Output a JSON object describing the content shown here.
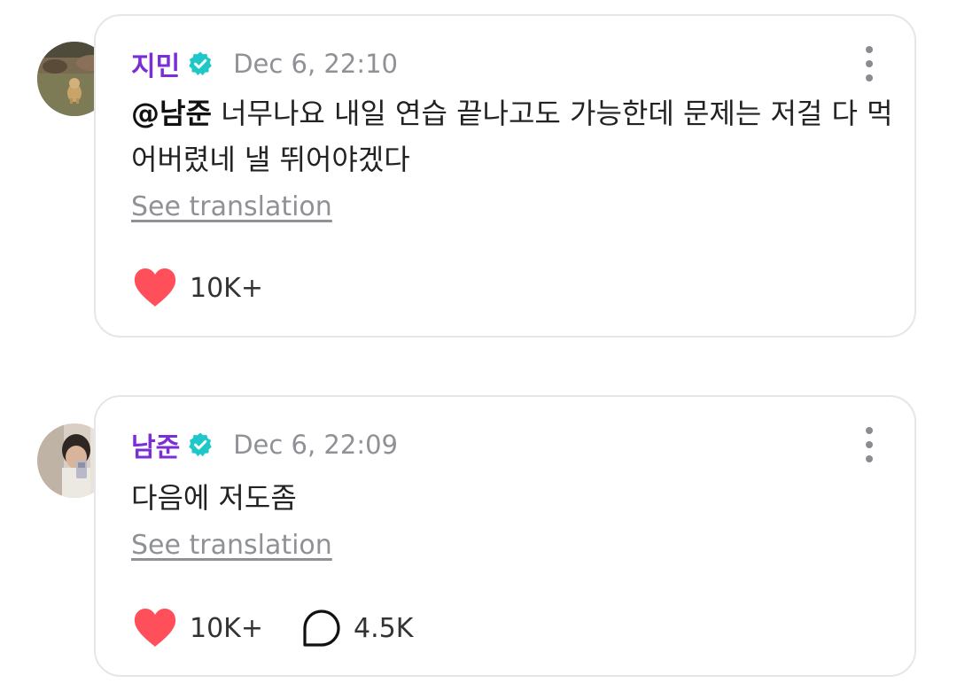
{
  "comments": [
    {
      "author": "지민",
      "verified": true,
      "timestamp": "Dec 6, 22:10",
      "mention": "@남준",
      "text": " 너무나요 내일 연습 끝나고도 가능한데 문제는 저걸 다 먹어버렸네 낼 뛰어야겠다",
      "translate_label": "See translation",
      "likes": "10K+",
      "avatar_icon": "dog-photo-avatar"
    },
    {
      "author": "남준",
      "verified": true,
      "timestamp": "Dec 6, 22:09",
      "text": "다음에 저도좀",
      "translate_label": "See translation",
      "likes": "10K+",
      "replies": "4.5K",
      "avatar_icon": "mirror-selfie-avatar"
    }
  ],
  "colors": {
    "author": "#7b2ed6",
    "verified_badge": "#1ec8c8",
    "heart": "#ff4f5a",
    "timestamp": "#8f9196",
    "card_border": "#e6e6e9"
  }
}
